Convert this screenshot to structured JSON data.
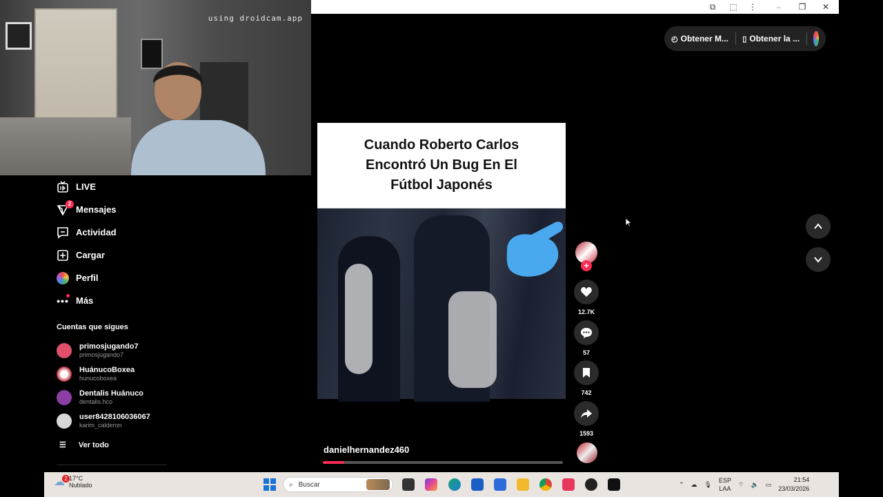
{
  "webcam": {
    "watermark": "using droidcam.app"
  },
  "header": {
    "get_app_label": "Obtener M...",
    "get_desktop_label": "Obtener la ..."
  },
  "sidebar": {
    "items": [
      {
        "label": "LIVE",
        "icon": "live-icon"
      },
      {
        "label": "Mensajes",
        "icon": "messages-icon",
        "badge": "2"
      },
      {
        "label": "Actividad",
        "icon": "activity-icon"
      },
      {
        "label": "Cargar",
        "icon": "upload-icon"
      },
      {
        "label": "Perfil",
        "icon": "profile-avatar"
      },
      {
        "label": "Más",
        "icon": "more-icon"
      }
    ],
    "following_title": "Cuentas que sigues",
    "following": [
      {
        "name": "primosjugando7",
        "handle": "primosjugando7",
        "color": "#e0506b"
      },
      {
        "name": "HuánucoBoxea",
        "handle": "hunucoboxea",
        "color": "#b9293a"
      },
      {
        "name": "Dentalis Huánuco",
        "handle": "dentalis.hco",
        "color": "#8d3ea4"
      },
      {
        "name": "user8428106036067",
        "handle": "karim_calderon",
        "color": "#d8d8d8"
      }
    ],
    "see_all": "Ver todo"
  },
  "video": {
    "caption": "Cuando Roberto Carlos Encontró Un Bug En El Fútbol Japonés",
    "author": "danielhernandez460",
    "progress": 0.09
  },
  "actions": {
    "likes": "12.7K",
    "comments": "57",
    "saves": "742",
    "shares": "1593"
  },
  "taskbar": {
    "temperature": "17°C",
    "weather": "Nublado",
    "weather_badge": "2",
    "search_placeholder": "Buscar",
    "lang_top": "ESP",
    "lang_bottom": "LAA",
    "time": "21:54",
    "date": "23/03/2026"
  },
  "colors": {
    "accent": "#fe2c55",
    "background": "#000000",
    "taskbar": "#e9e4df"
  }
}
